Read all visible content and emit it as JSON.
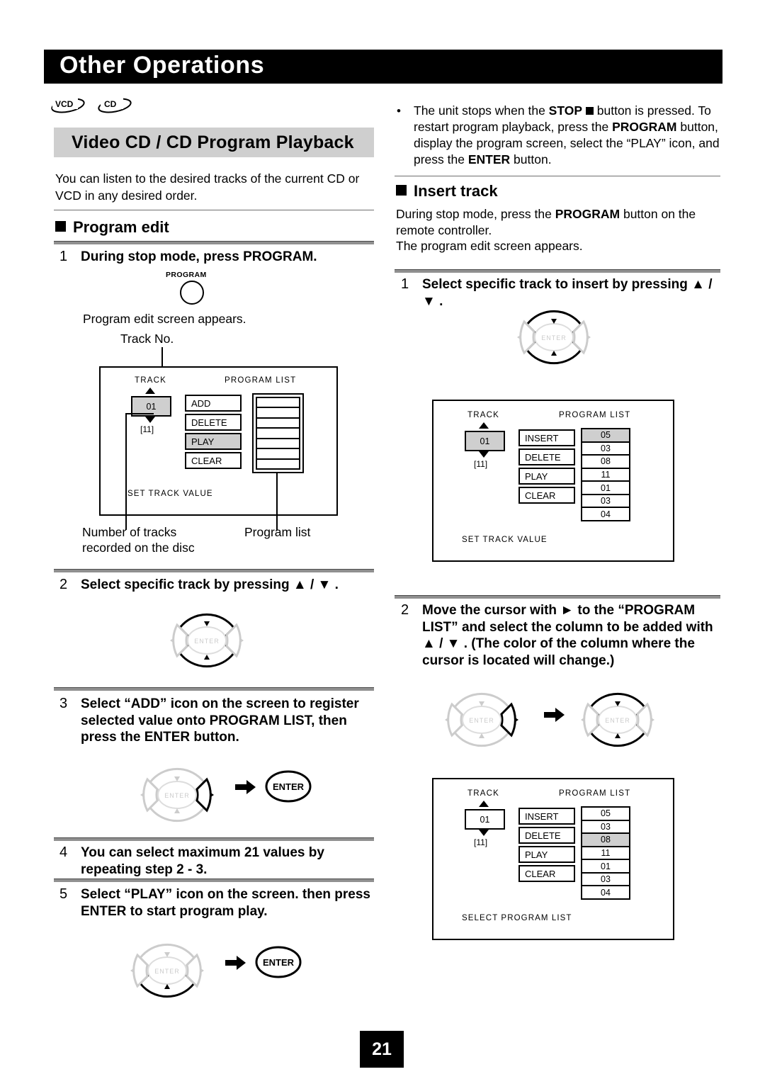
{
  "header": {
    "title": "Other Operations"
  },
  "disc_icons": [
    "VCD",
    "CD"
  ],
  "section": {
    "title": "Video CD / CD Program Playback"
  },
  "intro": "You can listen to the desired tracks of the current CD or VCD in any desired order.",
  "program_edit": {
    "heading": "Program edit",
    "steps": [
      {
        "n": "1",
        "text": "During stop mode, press PROGRAM."
      },
      {
        "n": "2",
        "text": "Select specific track by pressing ▲ / ▼ ."
      },
      {
        "n": "3",
        "text": "Select “ADD” icon on the screen to register selected value onto PROGRAM LIST, then press the ENTER button."
      },
      {
        "n": "4",
        "text": "You can select maximum 21 values by repeating step 2 - 3."
      },
      {
        "n": "5",
        "text": "Select “PLAY” icon on the screen. then press ENTER to start program play."
      }
    ],
    "program_button_label": "PROGRAM",
    "after_step1_note": "Program edit screen appears.",
    "callouts": {
      "track_no": "Track No.",
      "number_of_tracks": "Number of tracks recorded on the disc",
      "program_list": "Program list"
    }
  },
  "osd_program_edit": {
    "track_header": "TRACK",
    "track_value": "01",
    "track_total": "[11]",
    "list_header": "PROGRAM LIST",
    "commands": [
      {
        "label": "ADD",
        "highlighted": false
      },
      {
        "label": "DELETE",
        "highlighted": false
      },
      {
        "label": "PLAY",
        "highlighted": true
      },
      {
        "label": "CLEAR",
        "highlighted": false
      }
    ],
    "program_list": [
      "",
      "",
      "",
      "",
      "",
      "",
      ""
    ],
    "footer": "SET TRACK VALUE"
  },
  "note_stop": "The unit stops when the STOP ■ button is pressed. To restart program playback, press the PROGRAM button, display the program screen, select the “PLAY” icon, and press the ENTER button.",
  "insert_track": {
    "heading": "Insert track",
    "intro_line1": "During stop mode, press the PROGRAM button on the remote controller.",
    "intro_line2": "The program edit screen appears.",
    "steps": [
      {
        "n": "1",
        "text": "Select specific track to insert by pressing ▲ / ▼ ."
      },
      {
        "n": "2",
        "text": "Move the cursor with ► to the “PROGRAM LIST” and select the column to be added with ▲ / ▼ . (The color of the column where the cursor is located will change.)"
      }
    ]
  },
  "osd_insert_1": {
    "track_header": "TRACK",
    "track_value": "01",
    "track_total": "[11]",
    "track_highlighted": true,
    "list_header": "PROGRAM LIST",
    "commands": [
      {
        "label": "INSERT",
        "highlighted": false
      },
      {
        "label": "DELETE",
        "highlighted": false
      },
      {
        "label": "PLAY",
        "highlighted": false
      },
      {
        "label": "CLEAR",
        "highlighted": false
      }
    ],
    "program_list": [
      {
        "value": "05",
        "highlighted": true
      },
      {
        "value": "03",
        "highlighted": false
      },
      {
        "value": "08",
        "highlighted": false
      },
      {
        "value": "11",
        "highlighted": false
      },
      {
        "value": "01",
        "highlighted": false
      },
      {
        "value": "03",
        "highlighted": false
      },
      {
        "value": "04",
        "highlighted": false
      }
    ],
    "footer": "SET TRACK VALUE"
  },
  "osd_insert_2": {
    "track_header": "TRACK",
    "track_value": "01",
    "track_total": "[11]",
    "track_highlighted": false,
    "list_header": "PROGRAM LIST",
    "commands": [
      {
        "label": "INSERT",
        "highlighted": false
      },
      {
        "label": "DELETE",
        "highlighted": false
      },
      {
        "label": "PLAY",
        "highlighted": false
      },
      {
        "label": "CLEAR",
        "highlighted": false
      }
    ],
    "program_list": [
      {
        "value": "05",
        "highlighted": false
      },
      {
        "value": "03",
        "highlighted": false
      },
      {
        "value": "08",
        "highlighted": true
      },
      {
        "value": "11",
        "highlighted": false
      },
      {
        "value": "01",
        "highlighted": false
      },
      {
        "value": "03",
        "highlighted": false
      },
      {
        "value": "04",
        "highlighted": false
      }
    ],
    "footer": "SELECT PROGRAM LIST"
  },
  "controls": {
    "enter_label": "ENTER",
    "center_label": "ENTER"
  },
  "page_number": "21",
  "colors": {
    "highlight_gray": "#cfcfcf",
    "rule_gray": "#909090",
    "ink": "#000000",
    "inactive_gray": "#cccccc"
  }
}
